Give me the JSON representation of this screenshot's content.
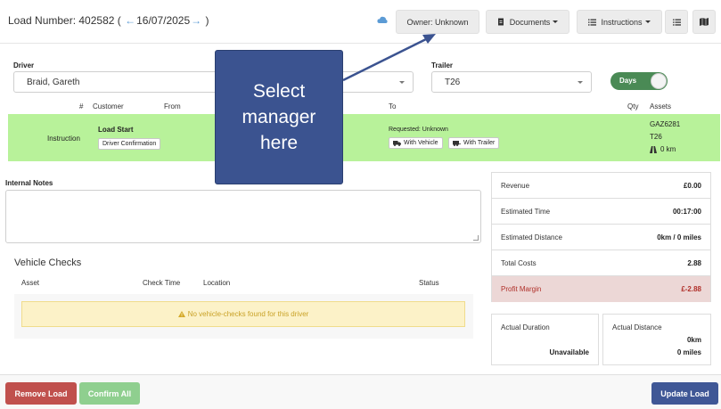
{
  "header": {
    "load_number": "Load Number: 402582 (",
    "prev_arrow": "←",
    "date": "16/07/2025",
    "next_arrow": "→",
    "close_paren": ")",
    "owner_button": "Owner: Unknown",
    "documents_button": "Documents",
    "instructions_button": "Instructions"
  },
  "driver": {
    "label": "Driver",
    "value": "Braid, Gareth"
  },
  "trailer": {
    "label": "Trailer",
    "value": "T26"
  },
  "toggle": {
    "label": "Days",
    "state": "on"
  },
  "table": {
    "columns": [
      "#",
      "Customer",
      "From",
      "To",
      "Qty",
      "Assets"
    ],
    "row": {
      "type": "Instruction",
      "title": "Load Start",
      "badge": "Driver Confirmation",
      "requested": "Requested: Unknown",
      "chip_vehicle": "With Vehicle",
      "chip_trailer": "With Trailer",
      "asset_vehicle": "GAZ6281",
      "asset_trailer": "T26",
      "asset_distance": "0 km"
    }
  },
  "notes": {
    "label": "Internal Notes",
    "value": ""
  },
  "vehicle_checks": {
    "title": "Vehicle Checks",
    "columns": [
      "Asset",
      "Check Time",
      "Location",
      "Status"
    ],
    "empty_message": "No vehicle-checks found for this driver"
  },
  "summary": [
    {
      "label": "Revenue",
      "value": "£0.00"
    },
    {
      "label": "Estimated Time",
      "value": "00:17:00"
    },
    {
      "label": "Estimated Distance",
      "value": "0km / 0 miles"
    },
    {
      "label": "Total Costs",
      "value": "2.88"
    },
    {
      "label": "Profit Margin",
      "value": "£-2.88"
    }
  ],
  "actual_duration": {
    "label": "Actual Duration",
    "value": "Unavailable"
  },
  "actual_distance": {
    "label": "Actual Distance",
    "km": "0km",
    "miles": "0 miles"
  },
  "footer": {
    "remove_load": "Remove Load",
    "confirm_all": "Confirm All",
    "update_load": "Update Load"
  },
  "callout": {
    "text": "Select manager here"
  },
  "colors": {
    "row_green": "#b8f29a",
    "callout_blue": "#3b5390",
    "remove_red": "#c0504d",
    "confirm_green": "#8fcf8f",
    "update_blue": "#3f5796",
    "profit_bg": "#ecd7d6"
  }
}
